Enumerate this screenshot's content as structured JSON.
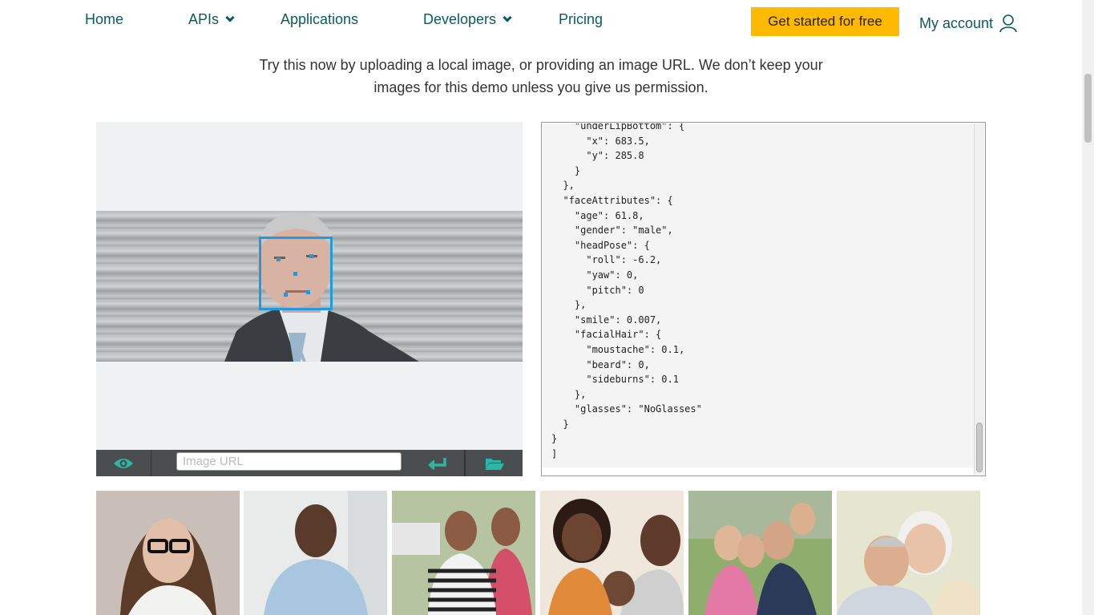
{
  "nav": {
    "home": "Home",
    "apis": "APIs",
    "applications": "Applications",
    "developers": "Developers",
    "pricing": "Pricing",
    "cta": "Get started for free",
    "account": "My account"
  },
  "intro": {
    "line1": "Try this now by uploading a local image, or providing an image URL. We don’t keep your",
    "line2": "images for this demo unless you give us permission."
  },
  "toolbar": {
    "url_placeholder": "Image URL"
  },
  "json_output": "    \"underLipBottom\": {\n      \"x\": 683.5,\n      \"y\": 285.8\n    }\n  },\n  \"faceAttributes\": {\n    \"age\": 61.8,\n    \"gender\": \"male\",\n    \"headPose\": {\n      \"roll\": -6.2,\n      \"yaw\": 0,\n      \"pitch\": 0\n    },\n    \"smile\": 0.007,\n    \"facialHair\": {\n      \"moustache\": 0.1,\n      \"beard\": 0,\n      \"sideburns\": 0.1\n    },\n    \"glasses\": \"NoGlasses\"\n  }\n}\n]",
  "colors": {
    "accent": "#ffb900",
    "nav_text": "#0b5a62",
    "toolbar_icon": "#2bb6a5",
    "face_box": "#1e9be0"
  },
  "icons": {
    "eye": "eye-icon",
    "enter": "enter-icon",
    "folder": "folder-icon",
    "user": "user-icon",
    "chevron": "chevron-down-icon"
  }
}
